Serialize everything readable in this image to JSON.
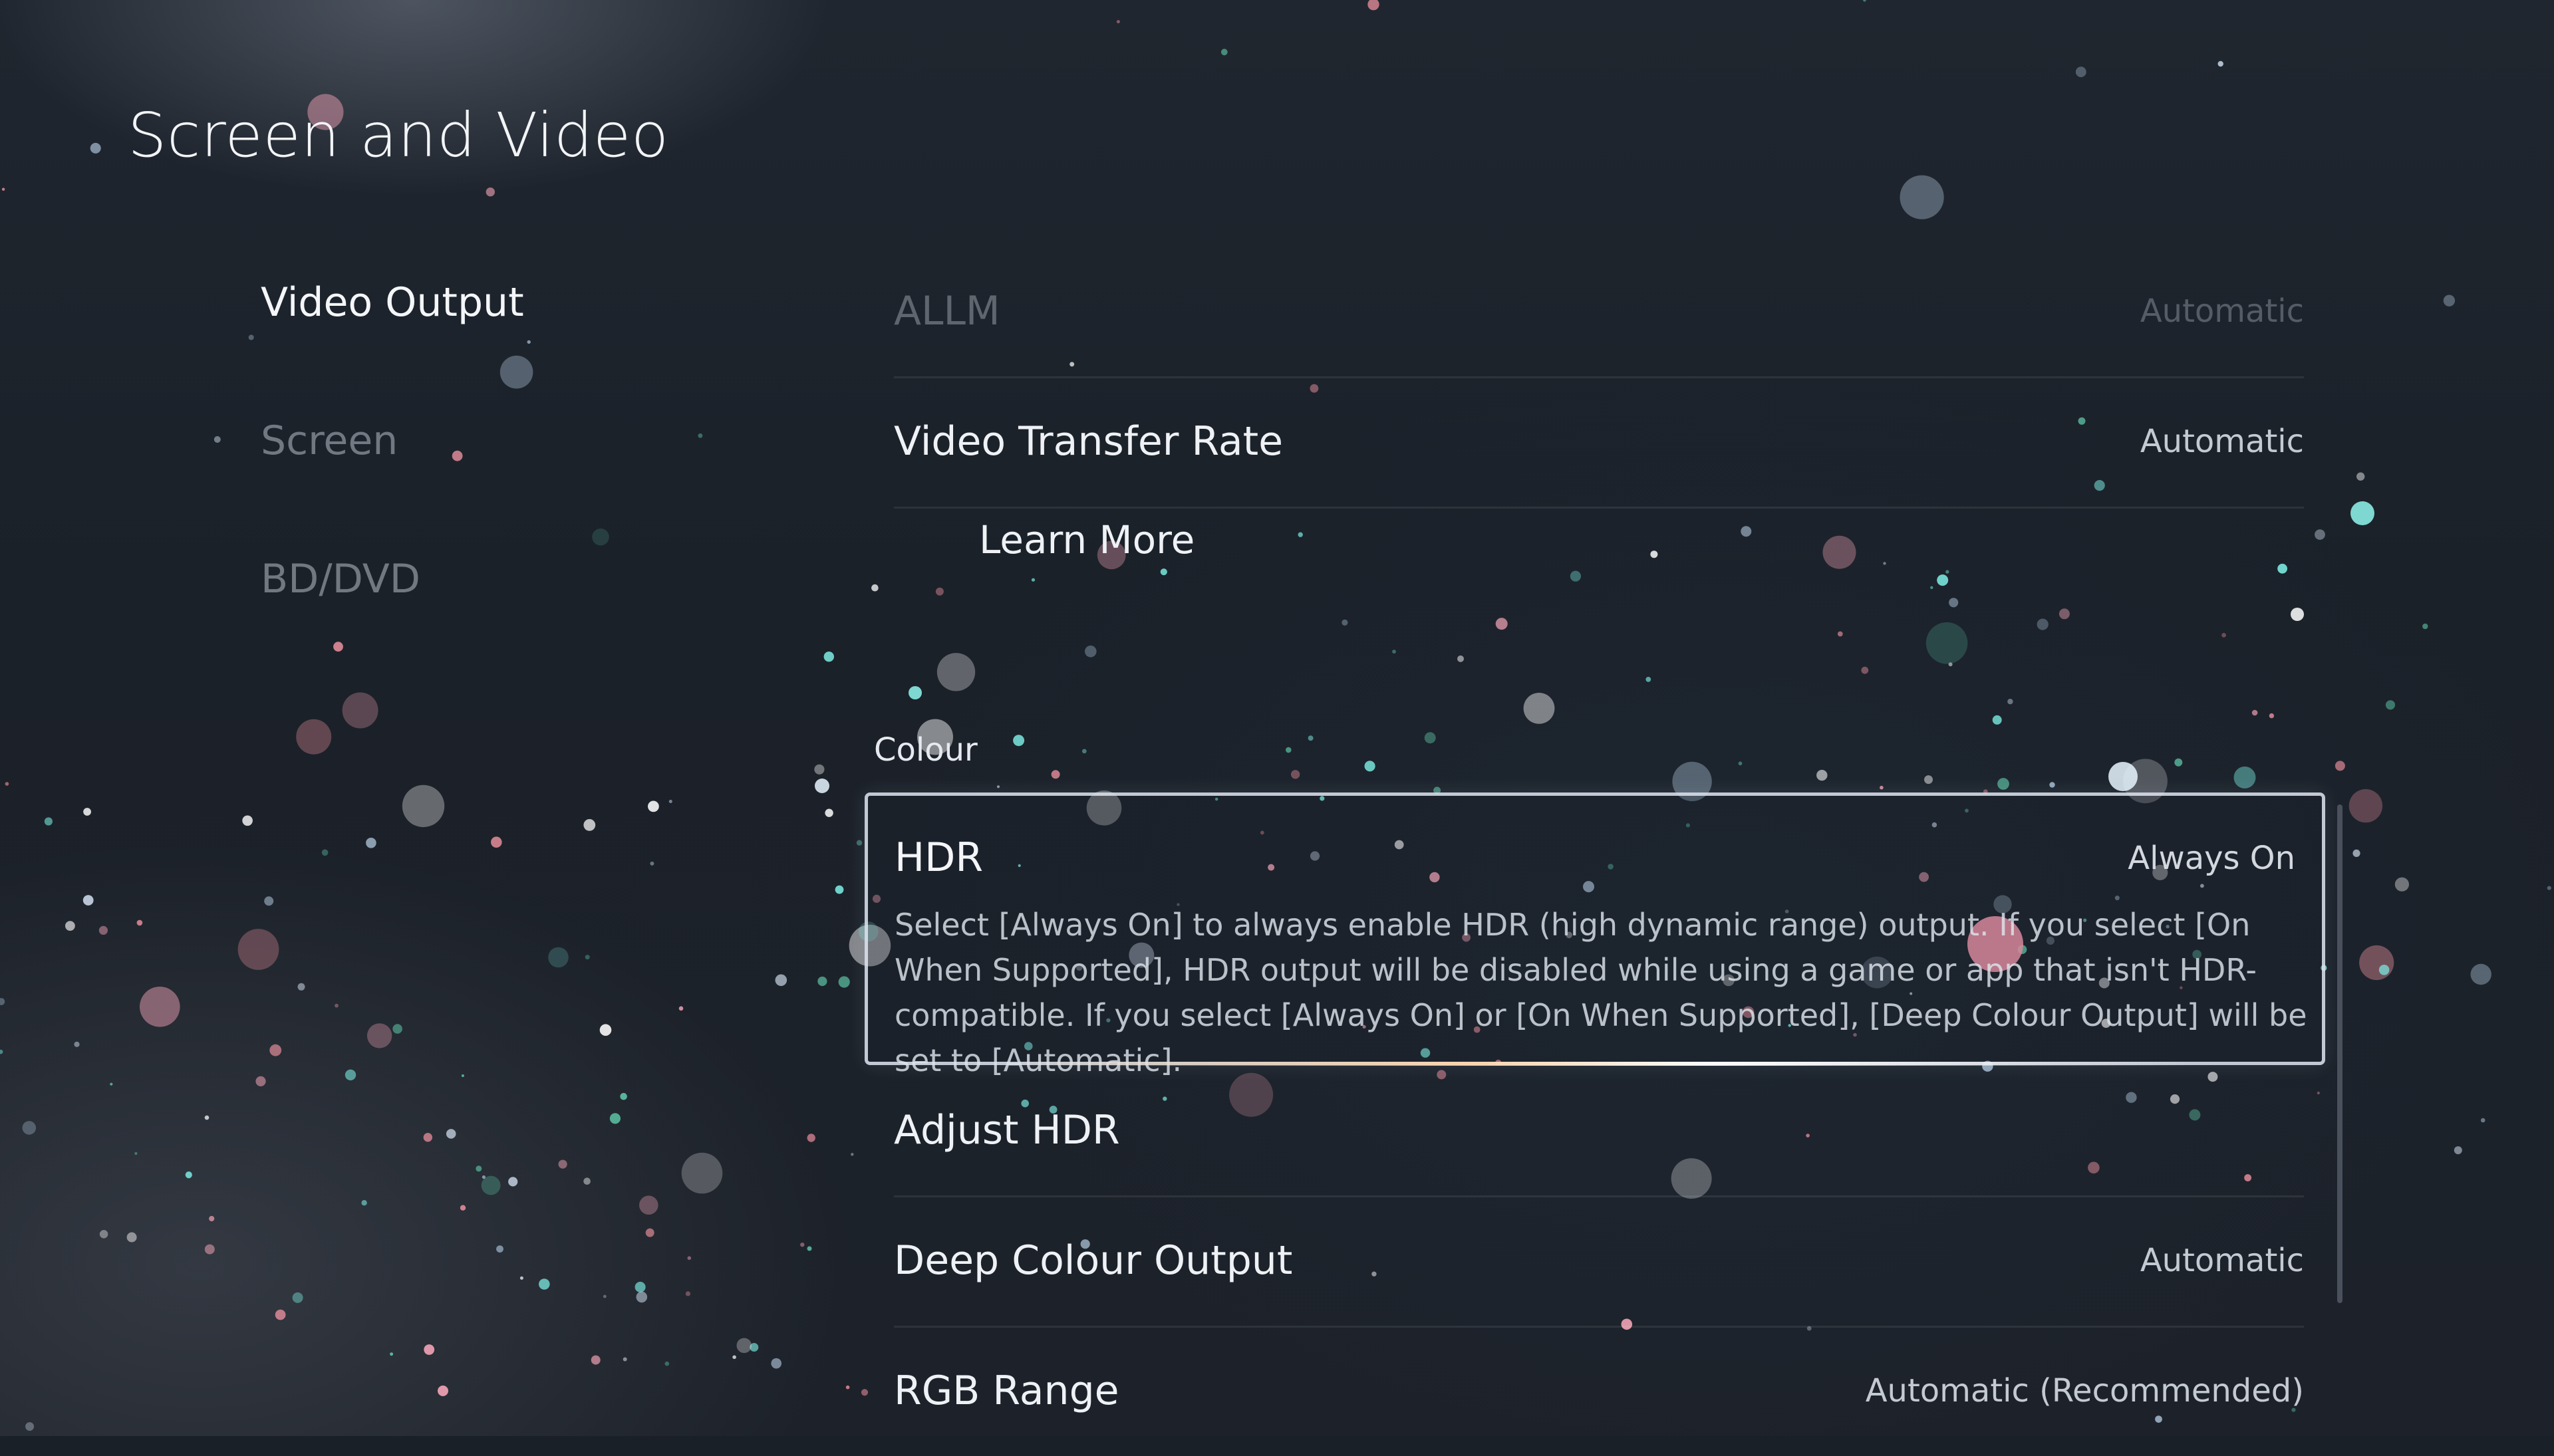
{
  "header": {
    "title": "Screen and Video"
  },
  "sidebar": {
    "items": [
      {
        "label": "Video Output",
        "active": true
      },
      {
        "label": "Screen",
        "active": false
      },
      {
        "label": "BD/DVD",
        "active": false
      }
    ]
  },
  "main": {
    "video_output_rows": [
      {
        "label": "ALLM",
        "value": "Automatic"
      },
      {
        "label": "Video Transfer Rate",
        "value": "Automatic"
      }
    ],
    "learn_more": "Learn More",
    "colour_section": {
      "header": "Colour",
      "hdr": {
        "label": "HDR",
        "value": "Always On",
        "description": "Select [Always On] to always enable HDR (high dynamic range) output. If you select [On When Supported], HDR output will be disabled while using a game or app that isn't HDR-compatible. If you select [Always On] or [On When Supported], [Deep Colour Output] will be set to [Automatic]."
      },
      "rows": [
        {
          "label": "Adjust HDR",
          "value": ""
        },
        {
          "label": "Deep Colour Output",
          "value": "Automatic"
        },
        {
          "label": "RGB Range",
          "value": "Automatic (Recommended)"
        }
      ]
    }
  },
  "colors": {
    "background": "#1b2129",
    "text_primary": "#eef1f5",
    "focus_border": "#e2e8f2",
    "particle_teal": "#7ef0e6",
    "particle_pink": "#f7a6b8"
  }
}
